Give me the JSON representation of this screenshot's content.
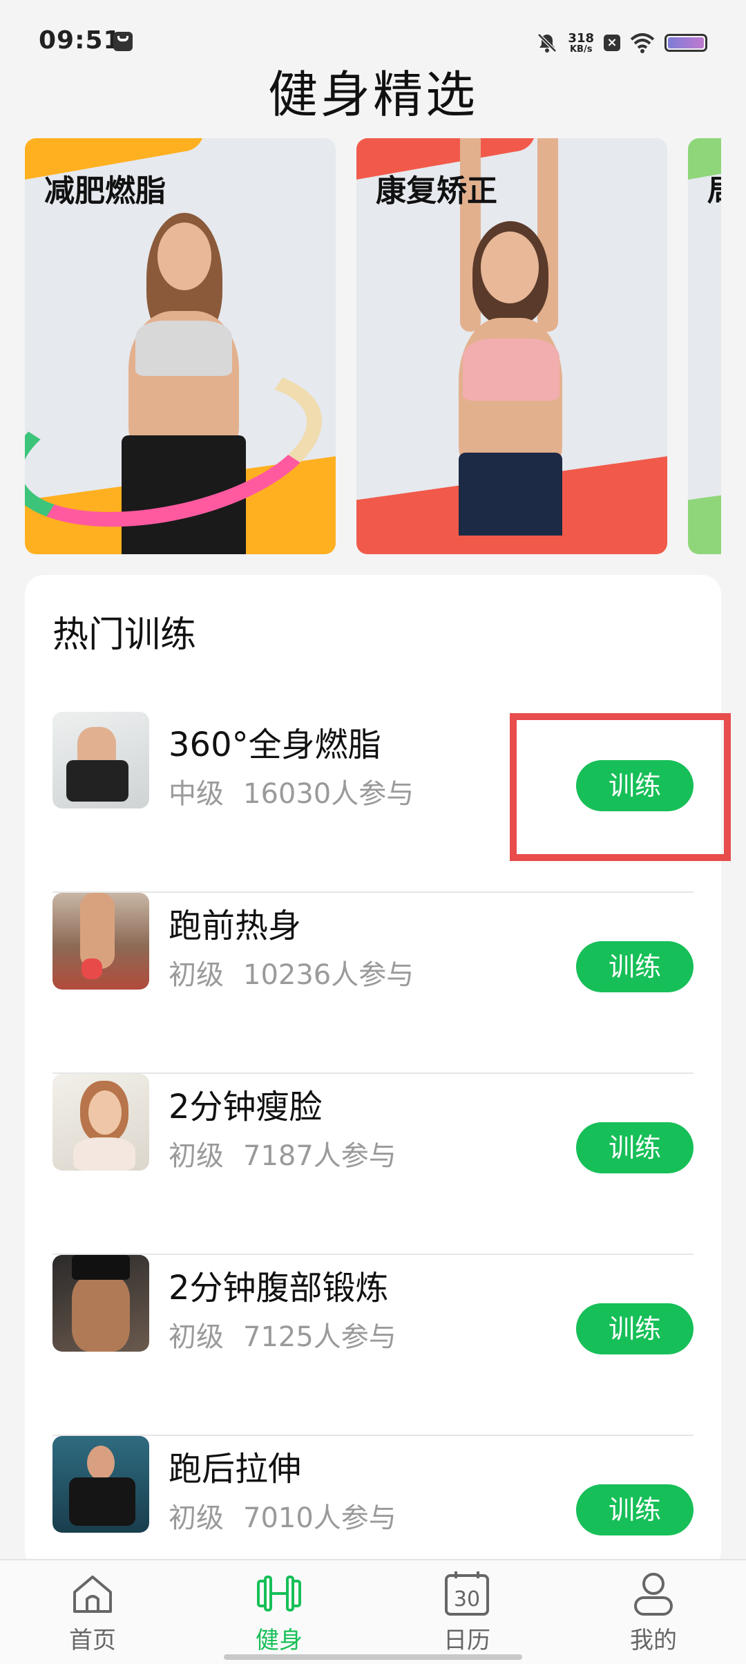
{
  "status_bar": {
    "time": "09:51",
    "net_speed_value": "318",
    "net_speed_unit": "KB/s",
    "icons": [
      "app-notification-icon",
      "mute-icon",
      "close-box-icon",
      "wifi-icon",
      "battery-icon"
    ]
  },
  "header": {
    "title": "健身精选"
  },
  "banners": [
    {
      "title": "减肥燃脂",
      "accent": "#ffb020"
    },
    {
      "title": "康复矫正",
      "accent": "#f15a4a"
    },
    {
      "title": "局",
      "accent": "#8fd67a"
    }
  ],
  "popular": {
    "title": "热门训练",
    "button_label": "训练",
    "items": [
      {
        "name": "360°全身燃脂",
        "level": "中级",
        "participants": "16030人参与"
      },
      {
        "name": "跑前热身",
        "level": "初级",
        "participants": "10236人参与"
      },
      {
        "name": "2分钟瘦脸",
        "level": "初级",
        "participants": "7187人参与"
      },
      {
        "name": "2分钟腹部锻炼",
        "level": "初级",
        "participants": "7125人参与"
      },
      {
        "name": "跑后拉伸",
        "level": "初级",
        "participants": "7010人参与"
      }
    ]
  },
  "bottom_nav": {
    "items": [
      {
        "label": "首页",
        "icon": "home-icon",
        "active": false
      },
      {
        "label": "健身",
        "icon": "dumbbell-icon",
        "active": true
      },
      {
        "label": "日历",
        "icon": "calendar-icon",
        "calendar_day": "30",
        "active": false
      },
      {
        "label": "我的",
        "icon": "person-icon",
        "active": false
      }
    ]
  },
  "colors": {
    "primary_green": "#17bf58",
    "highlight_red": "#e84c4c"
  }
}
